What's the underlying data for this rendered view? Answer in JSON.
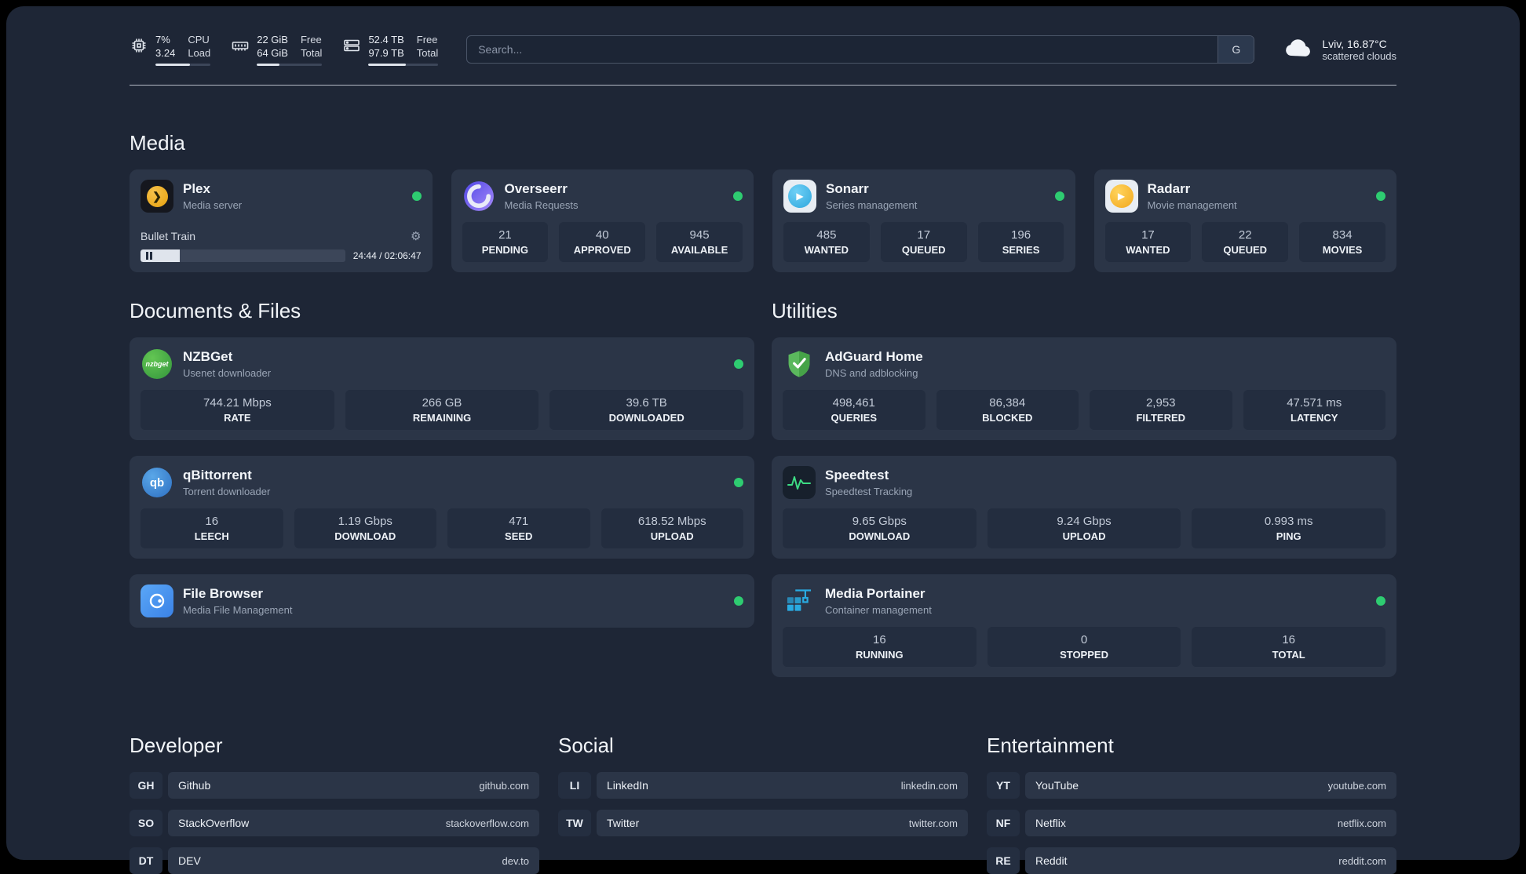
{
  "topbar": {
    "cpu": {
      "value1": "7%",
      "value2": "3.24",
      "label1": "CPU",
      "label2": "Load",
      "progress": 62
    },
    "ram": {
      "value1": "22 GiB",
      "value2": "64 GiB",
      "label1": "Free",
      "label2": "Total",
      "progress": 34
    },
    "disk": {
      "value1": "52.4 TB",
      "value2": "97.9 TB",
      "label1": "Free",
      "label2": "Total",
      "progress": 54
    },
    "search": {
      "placeholder": "Search...",
      "button_label": "G"
    },
    "weather": {
      "location": "Lviv, 16.87°C",
      "condition": "scattered clouds"
    }
  },
  "colors": {
    "status_online": "#2ecc71",
    "card_bg": "#2b3547",
    "page_bg": "#1e2636"
  },
  "sections": {
    "media": {
      "title": "Media",
      "plex": {
        "name": "Plex",
        "subtitle": "Media server",
        "track": "Bullet Train",
        "time": "24:44 / 02:06:47",
        "progress": 19
      },
      "overseerr": {
        "name": "Overseerr",
        "subtitle": "Media Requests",
        "stats": [
          {
            "value": "21",
            "label": "PENDING"
          },
          {
            "value": "40",
            "label": "APPROVED"
          },
          {
            "value": "945",
            "label": "AVAILABLE"
          }
        ]
      },
      "sonarr": {
        "name": "Sonarr",
        "subtitle": "Series management",
        "stats": [
          {
            "value": "485",
            "label": "WANTED"
          },
          {
            "value": "17",
            "label": "QUEUED"
          },
          {
            "value": "196",
            "label": "SERIES"
          }
        ]
      },
      "radarr": {
        "name": "Radarr",
        "subtitle": "Movie management",
        "stats": [
          {
            "value": "17",
            "label": "WANTED"
          },
          {
            "value": "22",
            "label": "QUEUED"
          },
          {
            "value": "834",
            "label": "MOVIES"
          }
        ]
      }
    },
    "documents": {
      "title": "Documents & Files",
      "nzbget": {
        "name": "NZBGet",
        "subtitle": "Usenet downloader",
        "logo_text": "nzbget",
        "stats": [
          {
            "value": "744.21 Mbps",
            "label": "RATE"
          },
          {
            "value": "266 GB",
            "label": "REMAINING"
          },
          {
            "value": "39.6 TB",
            "label": "DOWNLOADED"
          }
        ]
      },
      "qbittorrent": {
        "name": "qBittorrent",
        "subtitle": "Torrent downloader",
        "logo_text": "qb",
        "stats": [
          {
            "value": "16",
            "label": "LEECH"
          },
          {
            "value": "1.19 Gbps",
            "label": "DOWNLOAD"
          },
          {
            "value": "471",
            "label": "SEED"
          },
          {
            "value": "618.52 Mbps",
            "label": "UPLOAD"
          }
        ]
      },
      "filebrowser": {
        "name": "File Browser",
        "subtitle": "Media File Management"
      }
    },
    "utilities": {
      "title": "Utilities",
      "adguard": {
        "name": "AdGuard Home",
        "subtitle": "DNS and adblocking",
        "stats": [
          {
            "value": "498,461",
            "label": "QUERIES"
          },
          {
            "value": "86,384",
            "label": "BLOCKED"
          },
          {
            "value": "2,953",
            "label": "FILTERED"
          },
          {
            "value": "47.571 ms",
            "label": "LATENCY"
          }
        ]
      },
      "speedtest": {
        "name": "Speedtest",
        "subtitle": "Speedtest Tracking",
        "stats": [
          {
            "value": "9.65 Gbps",
            "label": "DOWNLOAD"
          },
          {
            "value": "9.24 Gbps",
            "label": "UPLOAD"
          },
          {
            "value": "0.993 ms",
            "label": "PING"
          }
        ]
      },
      "portainer": {
        "name": "Media Portainer",
        "subtitle": "Container management",
        "stats": [
          {
            "value": "16",
            "label": "RUNNING"
          },
          {
            "value": "0",
            "label": "STOPPED"
          },
          {
            "value": "16",
            "label": "TOTAL"
          }
        ]
      }
    }
  },
  "bookmarks": {
    "developer": {
      "title": "Developer",
      "items": [
        {
          "abbr": "GH",
          "name": "Github",
          "url": "github.com"
        },
        {
          "abbr": "SO",
          "name": "StackOverflow",
          "url": "stackoverflow.com"
        },
        {
          "abbr": "DT",
          "name": "DEV",
          "url": "dev.to"
        }
      ]
    },
    "social": {
      "title": "Social",
      "items": [
        {
          "abbr": "LI",
          "name": "LinkedIn",
          "url": "linkedin.com"
        },
        {
          "abbr": "TW",
          "name": "Twitter",
          "url": "twitter.com"
        }
      ]
    },
    "entertainment": {
      "title": "Entertainment",
      "items": [
        {
          "abbr": "YT",
          "name": "YouTube",
          "url": "youtube.com"
        },
        {
          "abbr": "NF",
          "name": "Netflix",
          "url": "netflix.com"
        },
        {
          "abbr": "RE",
          "name": "Reddit",
          "url": "reddit.com"
        }
      ]
    }
  }
}
